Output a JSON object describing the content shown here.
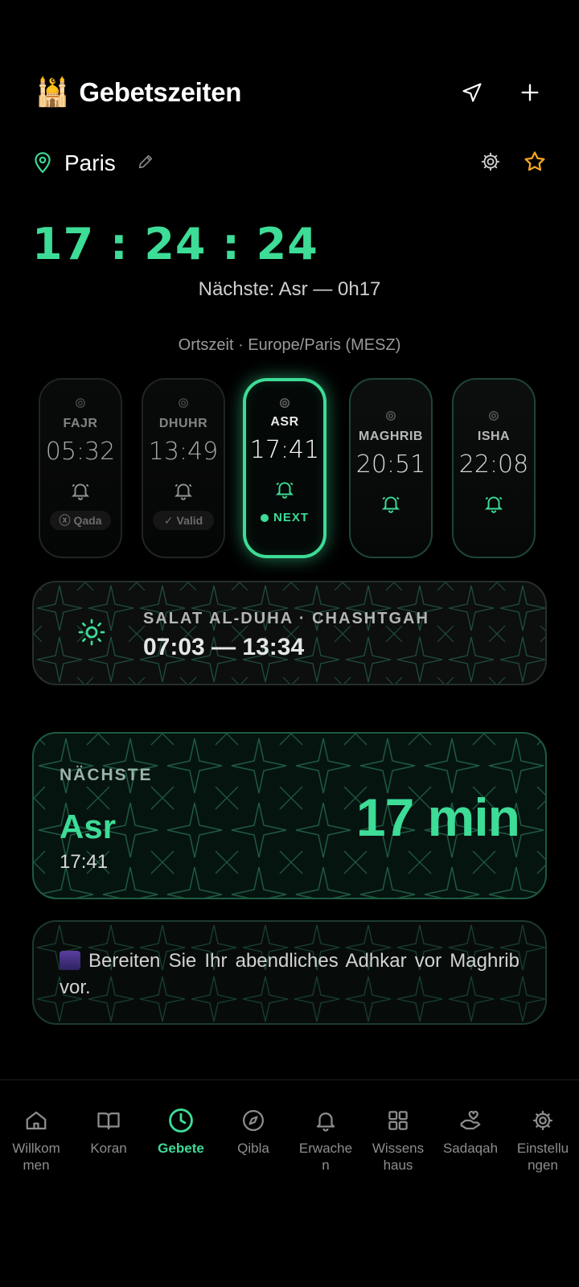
{
  "header": {
    "title": "Gebetszeiten",
    "icon": "mosque-emoji"
  },
  "location": {
    "city": "Paris"
  },
  "clock": "17 : 24 : 24",
  "next_summary": "Nächste: Asr — 0h17",
  "timezone": "Ortszeit · Europe/Paris (MESZ)",
  "prayers": [
    {
      "name": "FAJR",
      "time": "05:32",
      "status": "Qada"
    },
    {
      "name": "DHUHR",
      "time": "13:49",
      "status": "Valid"
    },
    {
      "name": "ASR",
      "time": "17:41",
      "status": "NEXT"
    },
    {
      "name": "MAGHRIB",
      "time": "20:51"
    },
    {
      "name": "ISHA",
      "time": "22:08"
    }
  ],
  "duha": {
    "label": "SALAT AL-DUHA · CHASHTGAH",
    "time": "07:03 — 13:34"
  },
  "next_prayer": {
    "label": "NÄCHSTE",
    "name": "Asr",
    "time": "17:41",
    "countdown": "17 min"
  },
  "tip": {
    "text": "Bereiten Sie Ihr abendliches Adhkar vor Maghrib vor."
  },
  "nav": [
    {
      "label": "Willkom men",
      "icon": "home-icon"
    },
    {
      "label": "Koran",
      "icon": "book-icon"
    },
    {
      "label": "Gebete",
      "icon": "clock-icon",
      "active": true
    },
    {
      "label": "Qibla",
      "icon": "compass-icon"
    },
    {
      "label": "Erwache n",
      "icon": "bell-icon"
    },
    {
      "label": "Wissens haus",
      "icon": "grid-icon"
    },
    {
      "label": "Sadaqah",
      "icon": "hand-heart-icon"
    },
    {
      "label": "Einstellu ngen",
      "icon": "gear-icon"
    }
  ],
  "colors": {
    "accent": "#3ddc97",
    "background": "#000000"
  }
}
